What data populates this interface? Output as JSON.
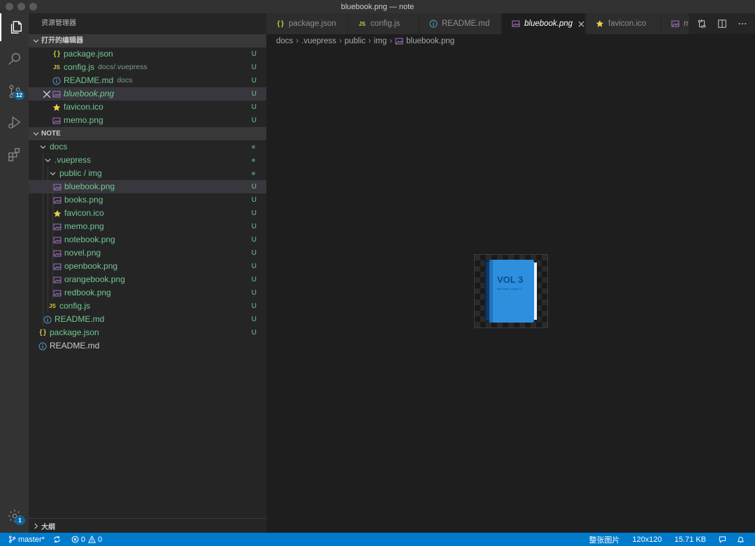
{
  "window": {
    "title": "bluebook.png — note"
  },
  "activity_bar": {
    "scm_badge": "12",
    "settings_badge": "1"
  },
  "sidebar": {
    "title": "资源管理器",
    "open_editors": {
      "header": "打开的编辑器",
      "items": [
        {
          "name": "package.json",
          "desc": "",
          "git": "U"
        },
        {
          "name": "config.js",
          "desc": "docs/.vuepress",
          "git": "U"
        },
        {
          "name": "README.md",
          "desc": "docs",
          "git": "U"
        },
        {
          "name": "bluebook.png",
          "desc": "",
          "git": "U"
        },
        {
          "name": "favicon.ico",
          "desc": "",
          "git": "U"
        },
        {
          "name": "memo.png",
          "desc": "",
          "git": "U"
        }
      ]
    },
    "folder": {
      "header": "NOTE",
      "tree": [
        {
          "name": "docs",
          "git": ""
        },
        {
          "name": ".vuepress",
          "git": ""
        },
        {
          "name": "public / img",
          "git": ""
        },
        {
          "name": "bluebook.png",
          "git": "U"
        },
        {
          "name": "books.png",
          "git": "U"
        },
        {
          "name": "favicon.ico",
          "git": "U"
        },
        {
          "name": "memo.png",
          "git": "U"
        },
        {
          "name": "notebook.png",
          "git": "U"
        },
        {
          "name": "novel.png",
          "git": "U"
        },
        {
          "name": "openbook.png",
          "git": "U"
        },
        {
          "name": "orangebook.png",
          "git": "U"
        },
        {
          "name": "redbook.png",
          "git": "U"
        },
        {
          "name": "config.js",
          "git": "U"
        },
        {
          "name": "README.md",
          "git": "U"
        },
        {
          "name": "package.json",
          "git": "U"
        },
        {
          "name": "README.md",
          "git": ""
        }
      ]
    },
    "outline": {
      "header": "大纲"
    }
  },
  "editor": {
    "tabs": [
      {
        "label": "package.json"
      },
      {
        "label": "config.js"
      },
      {
        "label": "README.md"
      },
      {
        "label": "bluebook.png"
      },
      {
        "label": "favicon.ico"
      },
      {
        "label": "me"
      }
    ],
    "breadcrumb": [
      "docs",
      ".vuepress",
      "public",
      "img",
      "bluebook.png"
    ],
    "preview": {
      "book_label": "VOL 3",
      "book_sublabel": "Blue Book • Volume 3"
    }
  },
  "statusbar": {
    "branch": "master*",
    "errors": "0",
    "warnings": "0",
    "fit": "整张图片",
    "dimensions": "120x120",
    "size": "15.71 KB"
  },
  "colors": {
    "accent": "#007acc",
    "untracked": "#73c991",
    "image_icon": "#a074c4",
    "json": "#cbcb41",
    "info": "#519aba"
  }
}
